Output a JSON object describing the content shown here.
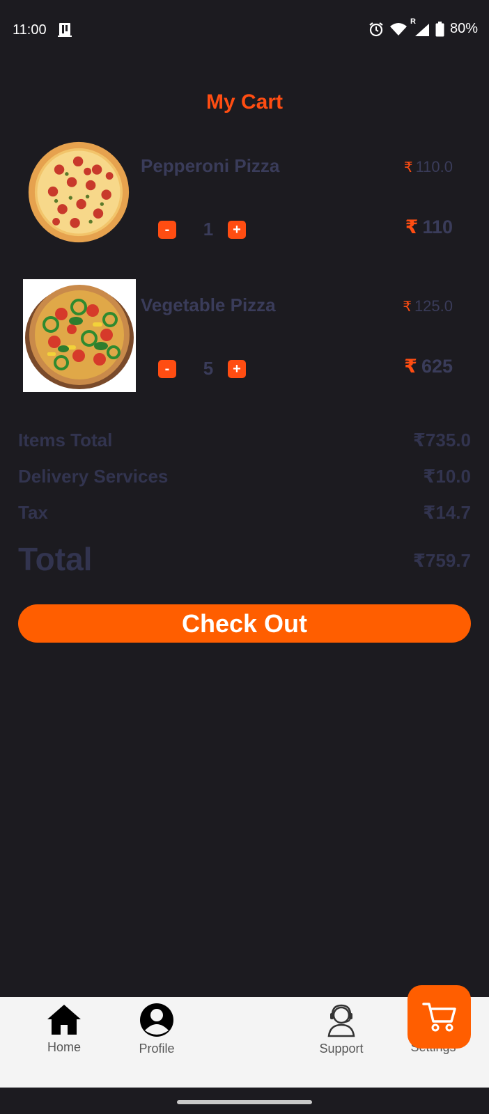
{
  "status_bar": {
    "time": "11:00",
    "battery": "80%",
    "signal_label": "R"
  },
  "page": {
    "title": "My Cart"
  },
  "currency_symbol": "₹",
  "cart_items": [
    {
      "name": "Pepperoni Pizza",
      "unit_price": "110.0",
      "quantity": "1",
      "line_total": "110",
      "image": "pepperoni-pizza-photo"
    },
    {
      "name": "Vegetable Pizza",
      "unit_price": "125.0",
      "quantity": "5",
      "line_total": "625",
      "image": "vegetable-pizza-photo"
    }
  ],
  "qty_controls": {
    "minus": "-",
    "plus": "+"
  },
  "summary": {
    "items_total_label": "Items Total",
    "items_total_value": "₹735.0",
    "delivery_label": "Delivery Services",
    "delivery_value": "₹10.0",
    "tax_label": "Tax",
    "tax_value": "₹14.7",
    "total_label": "Total",
    "total_value": "₹759.7"
  },
  "checkout": {
    "label": "Check Out"
  },
  "bottom_nav": {
    "items": [
      {
        "label": "Home",
        "icon": "home-icon"
      },
      {
        "label": "Profile",
        "icon": "profile-icon"
      },
      {
        "label": "Support",
        "icon": "support-agent-icon"
      },
      {
        "label": "Settings",
        "icon": "settings-icon"
      }
    ],
    "fab_icon": "cart-icon"
  },
  "colors": {
    "background": "#1c1b20",
    "accent": "#ff4d12",
    "button": "#ff5e00",
    "muted_text": "#3a3c5a",
    "nav_background": "#f4f4f4"
  }
}
